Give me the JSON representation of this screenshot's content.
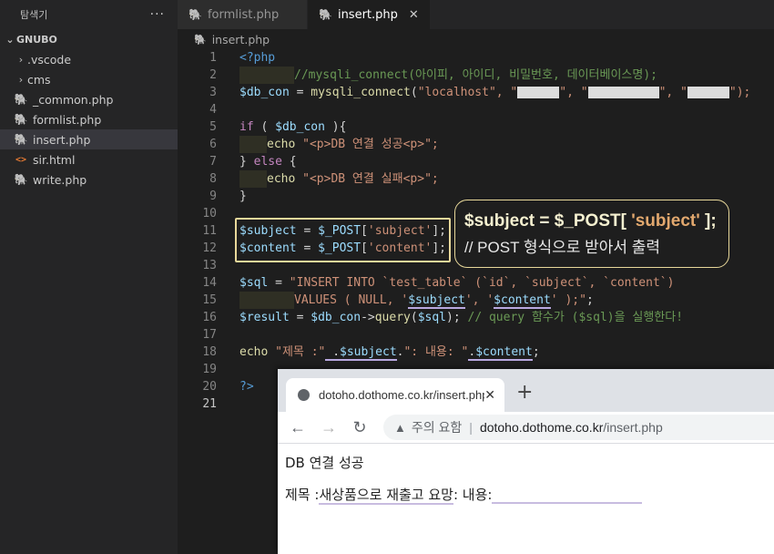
{
  "sidebar": {
    "title": "탐색기",
    "more": "···",
    "root": "GNUBO",
    "items": [
      {
        "label": ".vscode",
        "type": "folder"
      },
      {
        "label": "cms",
        "type": "folder"
      },
      {
        "label": "_common.php",
        "type": "php"
      },
      {
        "label": "formlist.php",
        "type": "php"
      },
      {
        "label": "insert.php",
        "type": "php",
        "active": true
      },
      {
        "label": "sir.html",
        "type": "html"
      },
      {
        "label": "write.php",
        "type": "php"
      }
    ]
  },
  "tabs": [
    {
      "label": "formlist.php"
    },
    {
      "label": "insert.php",
      "active": true
    }
  ],
  "breadcrumb": "insert.php",
  "code": {
    "line_numbers": [
      "1",
      "2",
      "3",
      "4",
      "5",
      "6",
      "7",
      "8",
      "9",
      "10",
      "11",
      "12",
      "13",
      "14",
      "15",
      "16",
      "17",
      "18",
      "19",
      "20",
      "21"
    ],
    "l1": "<?php",
    "l2": "//mysqli_connect(아이피, 아이디, 비밀번호, 데이터베이스명);",
    "l3a": "$db_con",
    "l3b": " = ",
    "l3c": "mysqli_connect",
    "l3d": "(",
    "l3e": "\"localhost\"",
    "l3f": ", \"",
    "l3g": "\", \"",
    "l3h": "\", \"",
    "l3i": "\");",
    "l5a": "if",
    "l5b": " ( ",
    "l5c": "$db_con",
    "l5d": " ){",
    "l6a": "echo",
    "l6b": " \"<p>DB 연결 성공<p>\";",
    "l7a": "}",
    "l7b": " else ",
    "l7c": "{",
    "l8a": "echo",
    "l8b": " \"<p>DB 연결 실패<p>\";",
    "l9": "}",
    "l11a": "$subject",
    "l11b": " = ",
    "l11c": "$_POST",
    "l11d": "[",
    "l11e": "'subject'",
    "l11f": "];",
    "l12a": "$content",
    "l12b": " = ",
    "l12c": "$_POST",
    "l12d": "[",
    "l12e": "'content'",
    "l12f": "];",
    "l14a": "$sql",
    "l14b": " = ",
    "l14c": "\"INSERT INTO `test_table` (`id`, `subject`, `content`)",
    "l15a": "VALUES ( NULL, '",
    "l15b": "$subject",
    "l15c": "', '",
    "l15d": "$content",
    "l15e": "' );\"",
    "l15f": ";",
    "l16a": "$result",
    "l16b": " = ",
    "l16c": "$db_con",
    "l16d": "->",
    "l16e": "query",
    "l16f": "(",
    "l16g": "$sql",
    "l16h": ");",
    "l16i": " // query 함수가 ($sql)을 실행한다!",
    "l18a": "echo",
    "l18b": " \"제목 :\"",
    "l18c": " .",
    "l18d": "$subject",
    "l18e": ".",
    "l18f": "\": 내용: \"",
    "l18g": ".",
    "l18h": "$content",
    "l18i": ";",
    "l20": "?>"
  },
  "callout": {
    "line1a": "$subject = $_POST[ ",
    "line1b": "'subject'",
    "line1c": " ];",
    "line2": "// POST 형식으로 받아서 출력"
  },
  "browser": {
    "tab_title": "dotoho.dothome.co.kr/insert.php",
    "warning": "주의 요함",
    "separator": "|",
    "host": "dotoho.dothome.co.kr",
    "path": "/insert.php",
    "line1": "DB 연결 성공",
    "line2_label": "제목 :",
    "line2_value": "새상품으로 재출고 요망",
    "line2_rest": ": 내용:"
  }
}
